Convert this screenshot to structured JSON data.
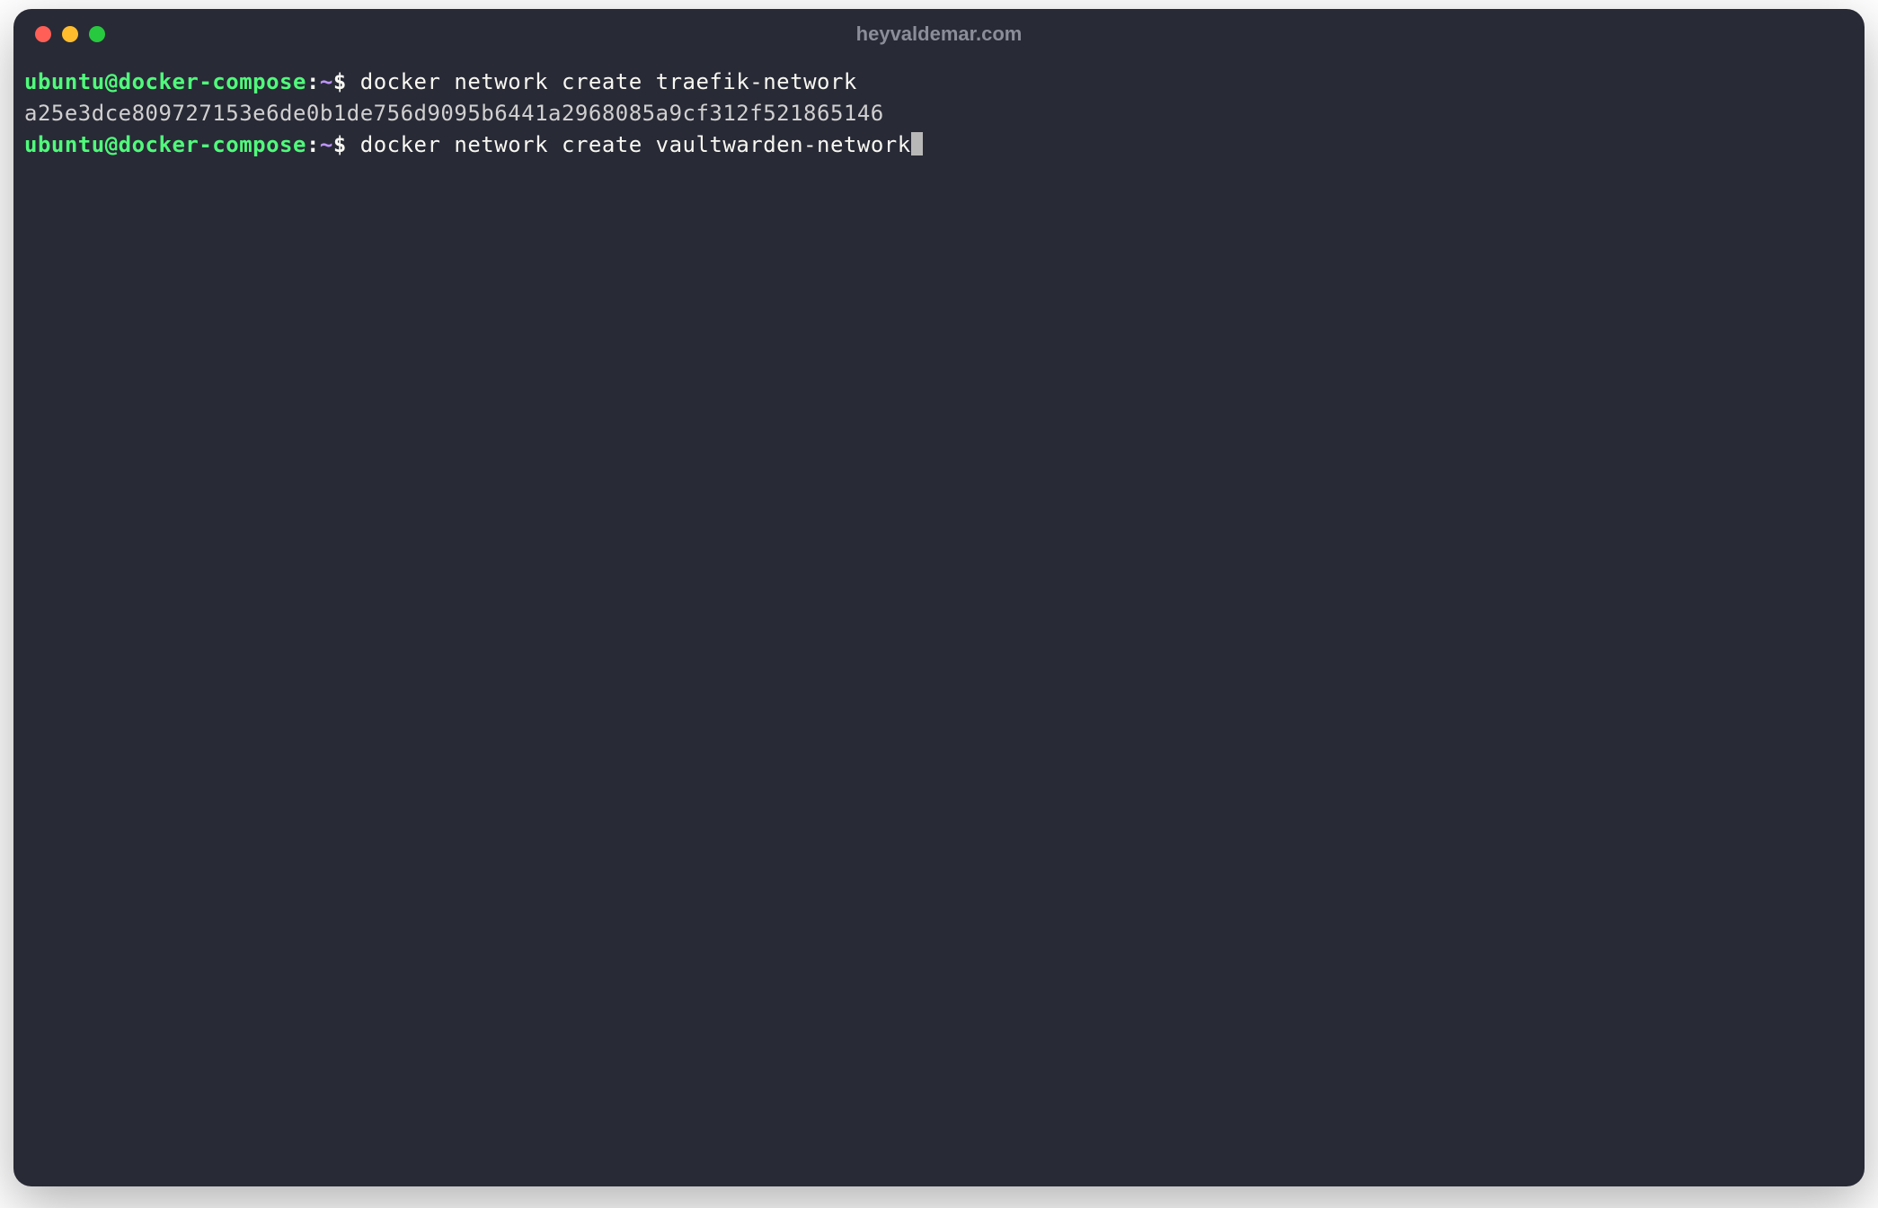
{
  "window": {
    "title": "heyvaldemar.com"
  },
  "prompt": {
    "user_host": "ubuntu@docker-compose",
    "colon": ":",
    "path": "~",
    "symbol": "$"
  },
  "lines": [
    {
      "type": "command",
      "text": "docker network create traefik-network"
    },
    {
      "type": "output",
      "text": "a25e3dce809727153e6de0b1de756d9095b6441a2968085a9cf312f521865146"
    },
    {
      "type": "command_active",
      "text": "docker network create vaultwarden-network"
    }
  ]
}
